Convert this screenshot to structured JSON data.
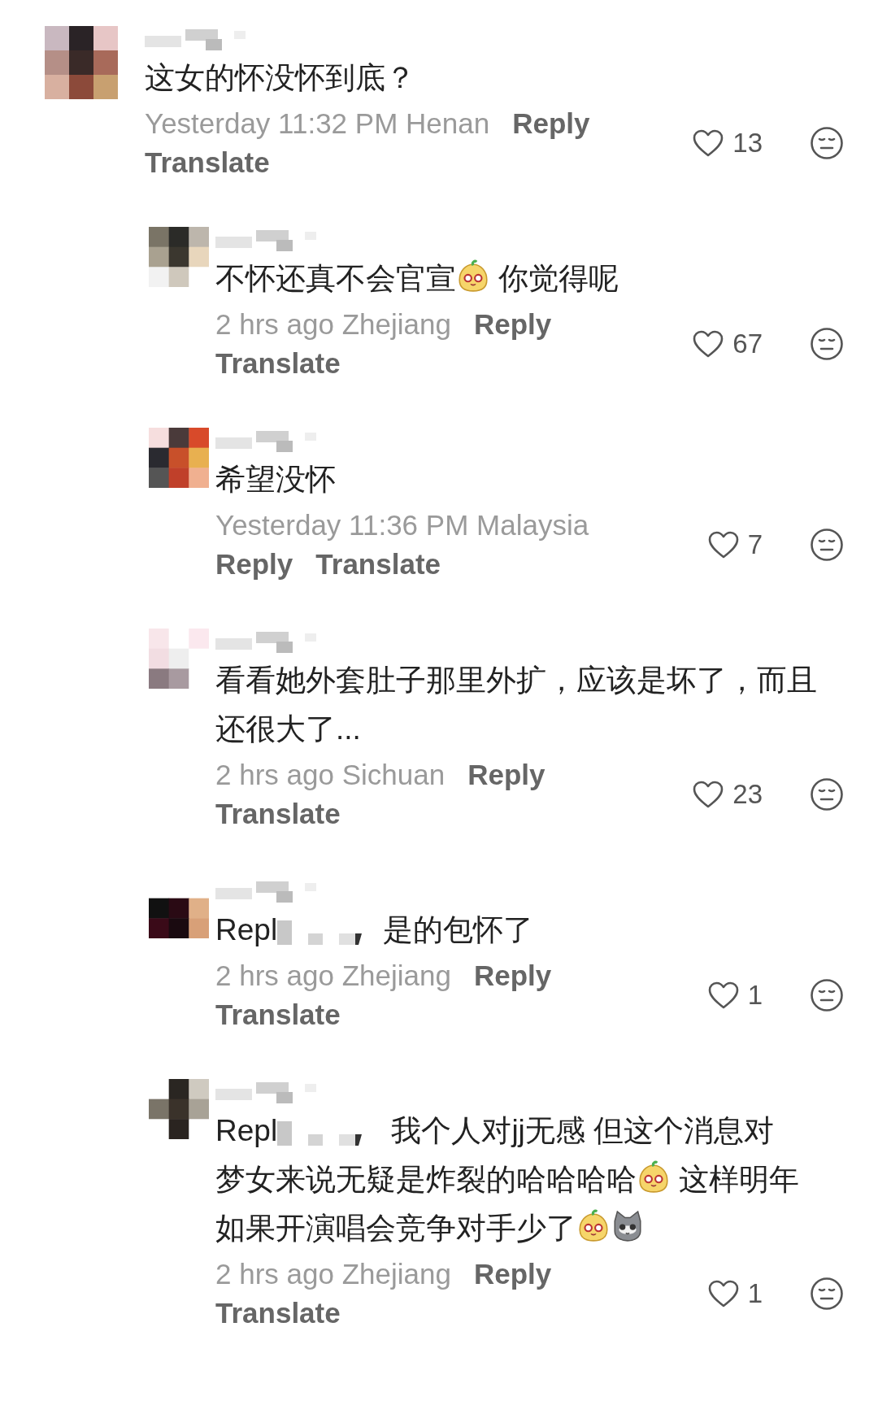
{
  "comments": [
    {
      "kind": "comment",
      "lines": [
        [
          {
            "kind": "text",
            "text": "这女的怀没怀到底？"
          }
        ]
      ],
      "time": "Yesterday 11:32 PM",
      "location": "Henan",
      "reply": "Reply",
      "translate": "Translate",
      "likes": "13"
    },
    {
      "kind": "reply",
      "lines": [
        [
          {
            "kind": "text",
            "text": "不怀还真不会官宣"
          },
          {
            "kind": "blob_emoji"
          },
          {
            "kind": "text",
            "text": " 你觉得呢"
          }
        ]
      ],
      "time": "2 hrs ago",
      "location": "Zhejiang",
      "reply": "Reply",
      "translate": "Translate",
      "likes": "67"
    },
    {
      "kind": "reply",
      "lines": [
        [
          {
            "kind": "text",
            "text": "希望没怀"
          }
        ]
      ],
      "time": "Yesterday 11:36 PM",
      "location": "Malaysia",
      "reply": "Reply",
      "translate": "Translate",
      "likes": "7"
    },
    {
      "kind": "reply",
      "lines": [
        [
          {
            "kind": "text",
            "text": "看看她外套肚子那里外扩，应该是坏了，而且"
          }
        ],
        [
          {
            "kind": "text",
            "text": "还很大了..."
          }
        ]
      ],
      "time": "2 hrs ago",
      "location": "Sichuan",
      "reply": "Reply",
      "translate": "Translate",
      "likes": "23"
    },
    {
      "kind": "reply",
      "lines": [
        [
          {
            "kind": "text",
            "text": "Repl"
          },
          {
            "kind": "redacted"
          },
          {
            "kind": "text",
            "text": "是的包怀了"
          }
        ]
      ],
      "time": "2 hrs ago",
      "location": "Zhejiang",
      "reply": "Reply",
      "translate": "Translate",
      "likes": "1"
    },
    {
      "kind": "reply",
      "lines": [
        [
          {
            "kind": "text",
            "text": "Repl"
          },
          {
            "kind": "redacted"
          },
          {
            "kind": "text",
            "text": " 我个人对jj无感 但这个消息对"
          }
        ],
        [
          {
            "kind": "text",
            "text": "梦女来说无疑是炸裂的哈哈哈哈"
          },
          {
            "kind": "blob_emoji"
          },
          {
            "kind": "text",
            "text": " 这样明年"
          }
        ],
        [
          {
            "kind": "text",
            "text": "如果开演唱会竞争对手少了"
          },
          {
            "kind": "blob_emoji"
          },
          {
            "kind": "cat_emoji"
          }
        ]
      ],
      "time": "2 hrs ago",
      "location": "Zhejiang",
      "reply": "Reply",
      "translate": "Translate",
      "likes": "1"
    }
  ]
}
